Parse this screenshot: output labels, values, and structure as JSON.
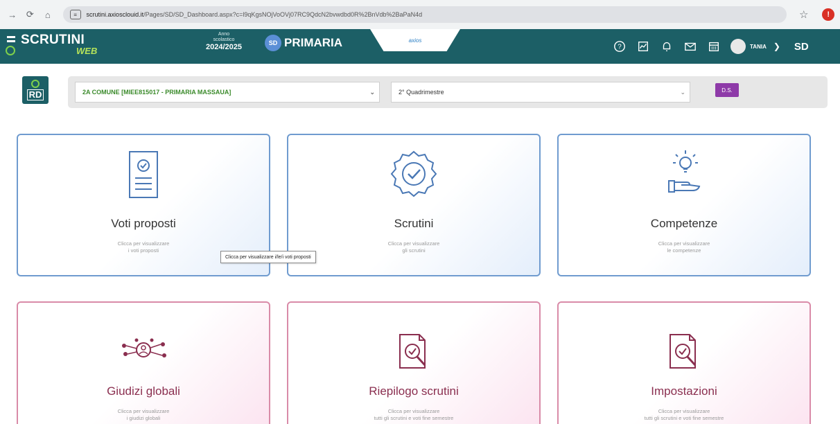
{
  "browser": {
    "url_domain": "scrutini.axiosclouid.it",
    "url_path": "/Pages/SD/SD_Dashboard.aspx?c=l9qKgsNOjVoOVj07RC9QdcN2bvwdbd0R%2BnVdb%2BaPaN4d"
  },
  "header": {
    "logo_text": "SCRUTINI",
    "logo_sub": "WEB",
    "year_label_1": "Anno",
    "year_label_2": "scolastico",
    "year_value": "2024/2025",
    "level_badge": "SD",
    "level_text": "PRIMARIA",
    "brand": "axios",
    "user_name": "TANIA",
    "right_label": "SD"
  },
  "rd_logo": "RD",
  "filters": {
    "class_value": "2A COMUNE [MIEE815017 - PRIMARIA MASSAUA]",
    "period_value": "2° Quadrimestre",
    "ds_button": "D.S."
  },
  "cards": [
    {
      "title": "Voti proposti",
      "sub1": "Clicca per visualizzare",
      "sub2": "i voti proposti",
      "icon": "document-check-icon"
    },
    {
      "title": "Scrutini",
      "sub1": "Clicca per visualizzare",
      "sub2": "gli scrutini",
      "icon": "badge-check-icon"
    },
    {
      "title": "Competenze",
      "sub1": "Clicca per visualizzare",
      "sub2": "le competenze",
      "icon": "lightbulb-hand-icon"
    },
    {
      "title": "Giudizi globali",
      "sub1": "Clicca per visualizzare",
      "sub2": "i giudizi globali",
      "icon": "network-user-icon"
    },
    {
      "title": "Riepilogo scrutini",
      "sub1": "Clicca per visualizzare",
      "sub2": "tutti gli scrutini e voti fine semestre",
      "icon": "document-search-icon"
    },
    {
      "title": "Impostazioni",
      "sub1": "Clicca per visualizzare",
      "sub2": "tutti gli scrutini e voti fine semestre",
      "icon": "document-search-icon"
    }
  ],
  "tooltip": "Clicca per visualizzare i/le/i voti proposti",
  "colors": {
    "header_bg": "#1c5f66",
    "accent_green": "#7fd14b",
    "card_blue": "#6f9bcf",
    "card_pink": "#d98ba8",
    "ds_purple": "#8e3aa8"
  }
}
